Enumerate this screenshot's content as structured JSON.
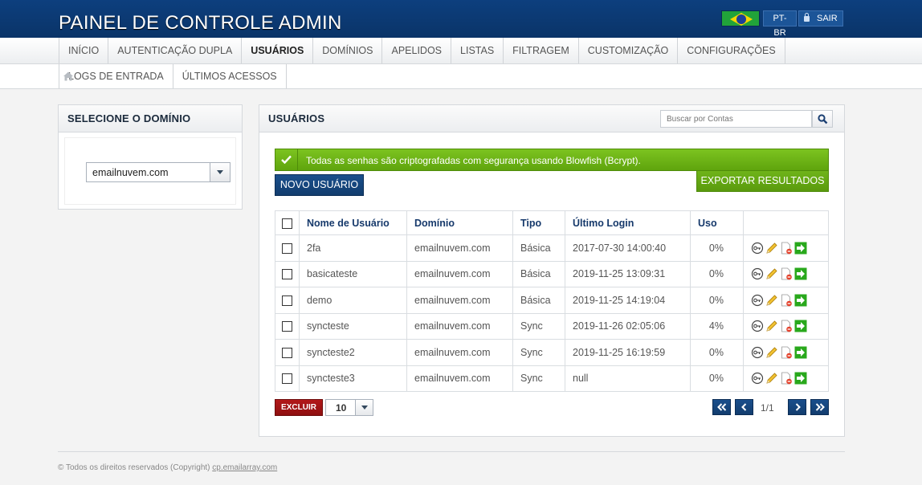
{
  "header": {
    "title": "PAINEL DE CONTROLE ADMIN",
    "flag_icon": "brazil-flag-icon",
    "lang_label": "PT-BR",
    "logout_label": "SAIR"
  },
  "nav": {
    "row1": [
      "INÍCIO",
      "AUTENTICAÇÃO DUPLA",
      "USUÁRIOS",
      "DOMÍNIOS",
      "APELIDOS",
      "LISTAS",
      "FILTRAGEM",
      "CUSTOMIZAÇÃO",
      "CONFIGURAÇÕES"
    ],
    "row2": [
      "LOGS DE ENTRADA",
      "ÚLTIMOS ACESSOS"
    ],
    "active": "USUÁRIOS"
  },
  "domain_panel": {
    "title": "SELECIONE O DOMÍNIO",
    "selected_domain": "emailnuvem.com"
  },
  "users_panel": {
    "title": "USUÁRIOS",
    "search_placeholder": "Buscar por Contas",
    "alert_message": "Todas as senhas são criptografadas com segurança usando Blowfish (Bcrypt).",
    "export_label": "EXPORTAR RESULTADOS",
    "new_user_label": "NOVO USUÁRIO",
    "columns": [
      "Nome de Usuário",
      "Domínio",
      "Tipo",
      "Último Login",
      "Uso"
    ],
    "rows": [
      {
        "user": "2fa",
        "domain": "emailnuvem.com",
        "type": "Básica",
        "last_login": "2017-07-30 14:00:40",
        "usage": "0%"
      },
      {
        "user": "basicateste",
        "domain": "emailnuvem.com",
        "type": "Básica",
        "last_login": "2019-11-25 13:09:31",
        "usage": "0%"
      },
      {
        "user": "demo",
        "domain": "emailnuvem.com",
        "type": "Básica",
        "last_login": "2019-11-25 14:19:04",
        "usage": "0%"
      },
      {
        "user": "syncteste",
        "domain": "emailnuvem.com",
        "type": "Sync",
        "last_login": "2019-11-26 02:05:06",
        "usage": "4%"
      },
      {
        "user": "syncteste2",
        "domain": "emailnuvem.com",
        "type": "Sync",
        "last_login": "2019-11-25 16:19:59",
        "usage": "0%"
      },
      {
        "user": "syncteste3",
        "domain": "emailnuvem.com",
        "type": "Sync",
        "last_login": "null",
        "usage": "0%"
      }
    ],
    "delete_label": "EXCLUIR",
    "page_size": "10",
    "page_info": "1/1"
  },
  "footer": {
    "text": "© Todos os direitos reservados (Copyright) ",
    "link": "cp.emailarray.com"
  },
  "colors": {
    "header_blue": "#0d3f7e",
    "alert_green": "#6fb41a",
    "button_blue": "#1a4f8c",
    "danger_red": "#b3191a"
  }
}
